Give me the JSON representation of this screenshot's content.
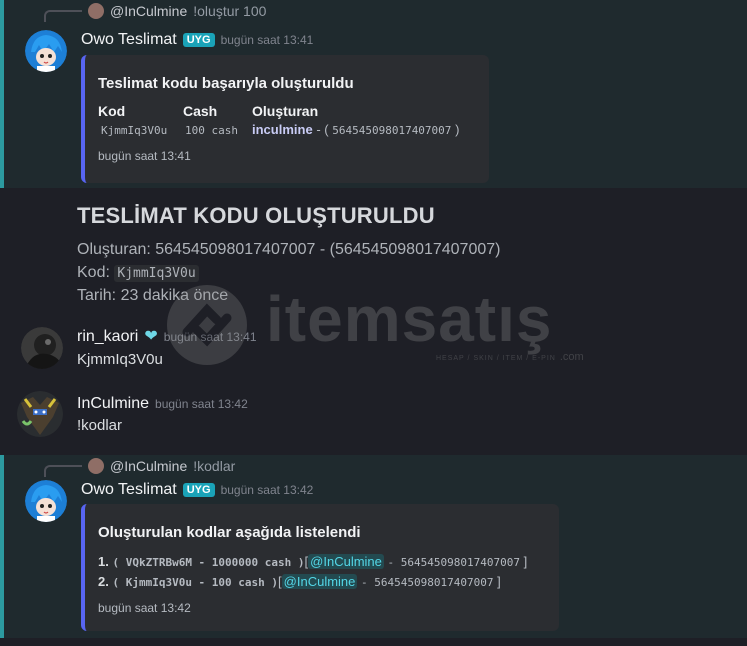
{
  "messages": {
    "m1": {
      "reply_user": "@InCulmine",
      "reply_text": "!oluştur 100",
      "author": "Owo Teslimat",
      "badge": "UYG",
      "time": "bugün saat 13:41",
      "embed": {
        "title": "Teslimat kodu başarıyla oluşturuldu",
        "col1_header": "Kod",
        "col2_header": "Cash",
        "col3_header": "Oluşturan",
        "col1_value": "KjmmIq3V0u",
        "col2_value": "100 cash",
        "col3_user": "inculmine",
        "col3_dash": "- (",
        "col3_id": "564545098017407007",
        "col3_close": ")",
        "footer": "bugün saat 13:41"
      }
    },
    "m2": {
      "heading": "TESLİMAT KODU OLUŞTURULDU",
      "line1": "Oluşturan: 564545098017407007 - (564545098017407007)",
      "kod_label": "Kod:",
      "kod_value": "KjmmIq3V0u",
      "tarih": "Tarih: 23 dakika önce"
    },
    "m3": {
      "author": "rin_kaori",
      "time": "bugün saat 13:41",
      "text": "KjmmIq3V0u"
    },
    "m4": {
      "author": "InCulmine",
      "time": "bugün saat 13:42",
      "text": "!kodlar"
    },
    "m5": {
      "reply_user": "@InCulmine",
      "reply_text": "!kodlar",
      "author": "Owo Teslimat",
      "badge": "UYG",
      "time": "bugün saat 13:42",
      "embed": {
        "title": "Oluşturulan kodlar aşağıda listelendi",
        "items": [
          {
            "num": "1.",
            "code": "( VQkZTRBw6M - 1000000 cash )",
            "open": "[",
            "mention": "@InCulmine",
            "rest": "- 564545098017407007",
            "close": "]"
          },
          {
            "num": "2.",
            "code": "( KjmmIq3V0u - 100 cash )",
            "open": "[",
            "mention": "@InCulmine",
            "rest": "- 564545098017407007",
            "close": "]"
          }
        ],
        "footer": "bugün saat 13:42"
      }
    }
  },
  "watermark": {
    "brand": "itemsatış",
    "tagline": "HESAP / SKIN / ITEM / E-PIN",
    "suffix": ".com"
  },
  "colors": {
    "background": "#1e1f26",
    "highlight": "#1f2a2e",
    "highlight_bar": "#2c9aa0",
    "embed_bar": "#5865f2",
    "badge": "#1aa3b8",
    "mention": "#53d6e6"
  }
}
